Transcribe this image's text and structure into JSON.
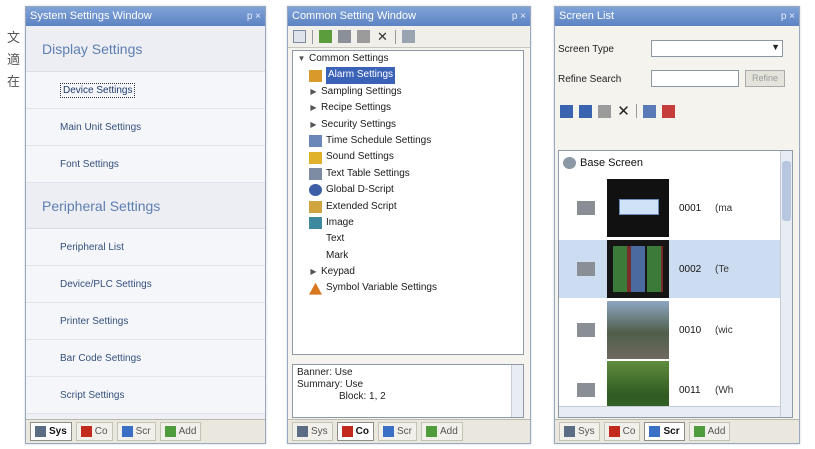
{
  "margin_text": [
    "文",
    "適",
    "在"
  ],
  "system_panel": {
    "title": "System Settings Window",
    "title_controls": "p ×",
    "categories": [
      {
        "label": "Display Settings",
        "items": [
          "Device Settings",
          "Main Unit Settings",
          "Font Settings"
        ]
      },
      {
        "label": "Peripheral Settings",
        "items": [
          "Peripheral List",
          "Device/PLC Settings",
          "Printer Settings",
          "Bar Code Settings",
          "Script Settings"
        ]
      }
    ],
    "selected_item": "Device Settings"
  },
  "common_panel": {
    "title": "Common Setting Window",
    "title_controls": "p ×",
    "tree": [
      {
        "label": "Common Settings",
        "icon": "expanded-arrow",
        "level": 0
      },
      {
        "label": "Alarm Settings",
        "icon": "alarm-icon",
        "level": 1,
        "highlighted": true
      },
      {
        "label": "Sampling Settings",
        "icon": "collapsed-arrow",
        "level": 1
      },
      {
        "label": "Recipe Settings",
        "icon": "collapsed-arrow",
        "level": 1
      },
      {
        "label": "Security Settings",
        "icon": "collapsed-arrow",
        "level": 1
      },
      {
        "label": "Time Schedule Settings",
        "icon": "schedule-icon",
        "level": 1
      },
      {
        "label": "Sound Settings",
        "icon": "sound-icon",
        "level": 1
      },
      {
        "label": "Text Table Settings",
        "icon": "text-table-icon",
        "level": 1
      },
      {
        "label": "Global D-Script",
        "icon": "globe-icon",
        "level": 1
      },
      {
        "label": "Extended Script",
        "icon": "script-icon",
        "level": 1
      },
      {
        "label": "Image",
        "icon": "image-icon",
        "level": 1
      },
      {
        "label": "Text",
        "icon": "none",
        "level": 1
      },
      {
        "label": "Mark",
        "icon": "none",
        "level": 1
      },
      {
        "label": "Keypad",
        "icon": "collapsed-arrow",
        "level": 1
      },
      {
        "label": "Symbol Variable Settings",
        "icon": "symbol-variable-icon",
        "level": 1
      }
    ],
    "description": {
      "line1": "Banner: Use",
      "line2": "Summary: Use",
      "line3": "Block: 1, 2"
    }
  },
  "screen_panel": {
    "title": "Screen List",
    "title_controls": "p ×",
    "screen_type_label": "Screen Type",
    "refine_search_label": "Refine Search",
    "refine_button": "Refine",
    "list_header": "Base Screen",
    "screens": [
      {
        "number": "0001",
        "name": "(ma",
        "selected": false
      },
      {
        "number": "0002",
        "name": "(Te",
        "selected": true
      },
      {
        "number": "0010",
        "name": "(wic",
        "selected": false
      },
      {
        "number": "0011",
        "name": "(Wh",
        "selected": false
      }
    ]
  },
  "tabs": [
    {
      "key": "sys",
      "label": "Sys"
    },
    {
      "key": "co",
      "label": "Co"
    },
    {
      "key": "scr",
      "label": "Scr"
    },
    {
      "key": "add",
      "label": "Add"
    }
  ],
  "colors": {
    "titlebar": "#6b8fcc",
    "selection": "#3a63b8",
    "category_text": "#5d7fb0"
  }
}
